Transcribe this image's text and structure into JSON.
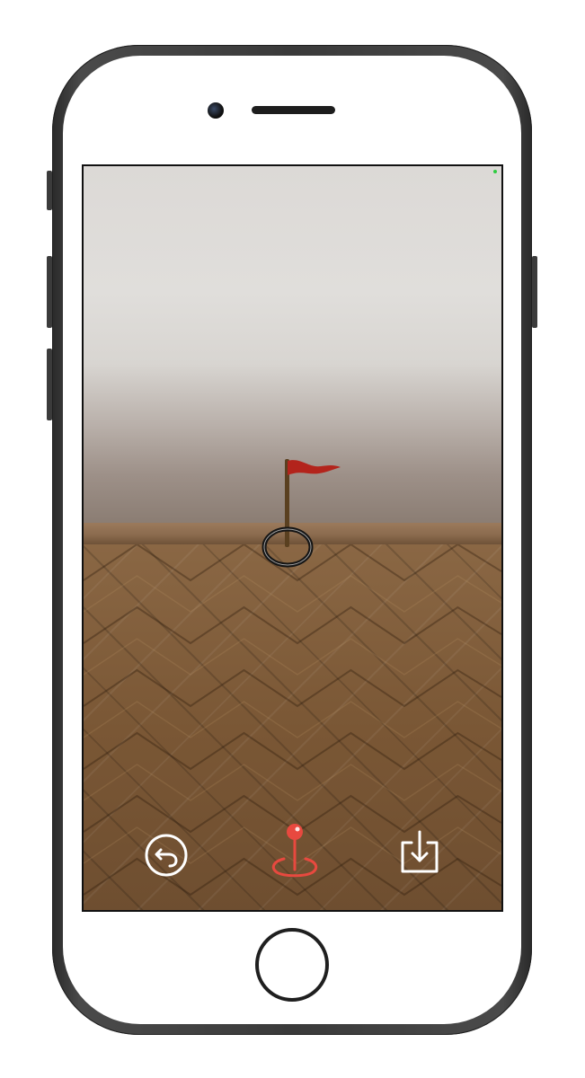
{
  "device": {
    "frame_color": "#3a3a3a",
    "face_color": "#ffffff"
  },
  "screen": {
    "status_dot_color": "#2ecc40"
  },
  "ar_scene": {
    "flag_color": "#b3241c",
    "pole_color": "#5a4020",
    "target_ring_color": "#151515"
  },
  "controls": {
    "undo": {
      "icon": "undo-arrow-icon",
      "color": "#ffffff"
    },
    "place": {
      "icon": "map-pin-icon",
      "color": "#e8493f"
    },
    "save": {
      "icon": "download-tray-icon",
      "color": "#ffffff"
    }
  }
}
